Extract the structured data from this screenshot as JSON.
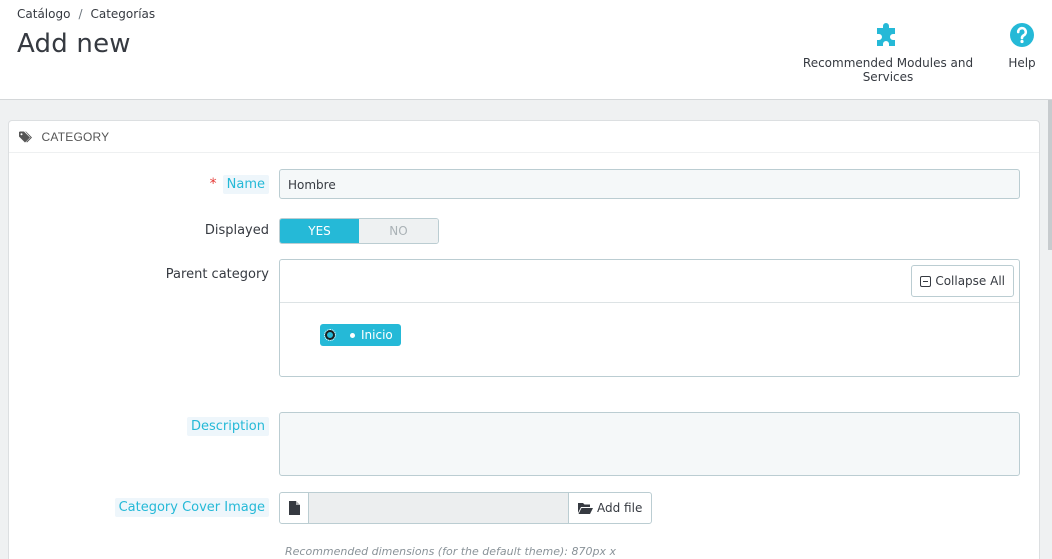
{
  "breadcrumb": {
    "items": [
      "Catálogo",
      "Categorías"
    ],
    "separator": "/"
  },
  "header": {
    "title": "Add new",
    "toolbar": {
      "modules_label": "Recommended Modules and Services",
      "help_label": "Help"
    }
  },
  "panel": {
    "heading": "CATEGORY",
    "fields": {
      "name": {
        "label": "Name",
        "required_mark": "*",
        "value": "Hombre"
      },
      "displayed": {
        "label": "Displayed",
        "yes": "YES",
        "no": "NO",
        "value": "YES"
      },
      "parent": {
        "label": "Parent category",
        "collapse_label": "Collapse All",
        "node_label": "Inicio"
      },
      "description": {
        "label": "Description",
        "value": ""
      },
      "cover": {
        "label": "Category Cover Image",
        "add_file_label": "Add file",
        "help": "Recommended dimensions (for the default theme): 870px x"
      }
    }
  },
  "colors": {
    "accent": "#25b9d7",
    "required": "#e53935",
    "text": "#363a41"
  }
}
